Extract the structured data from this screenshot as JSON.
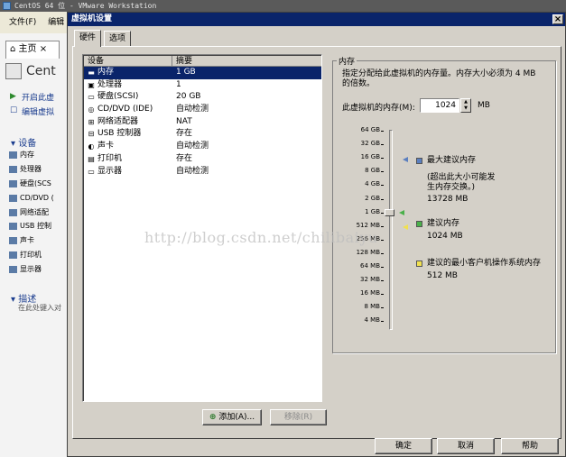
{
  "background": {
    "title": "CentOS 64 位 - VMware Workstation",
    "menu": [
      "文件(F)",
      "编辑"
    ],
    "home_tab": "主页",
    "vm_title": "Cent",
    "actions": [
      "开启此虚",
      "编辑虚拟"
    ],
    "devices_heading": "设备",
    "devices": [
      "内存",
      "处理器",
      "硬盘(SCS",
      "CD/DVD (",
      "网络适配",
      "USB 控制",
      "声卡",
      "打印机",
      "显示器"
    ],
    "description_heading": "描述",
    "description_placeholder": "在此处键入对"
  },
  "dialog": {
    "title": "虚拟机设置",
    "tabs": [
      "硬件",
      "选项"
    ],
    "device_table": {
      "headers": [
        "设备",
        "摘要"
      ],
      "rows": [
        {
          "icon": "memory-icon",
          "device": "内存",
          "summary": "1 GB",
          "selected": true
        },
        {
          "icon": "cpu-icon",
          "device": "处理器",
          "summary": "1"
        },
        {
          "icon": "hard-disk-icon",
          "device": "硬盘(SCSI)",
          "summary": "20 GB"
        },
        {
          "icon": "cd-dvd-icon",
          "device": "CD/DVD (IDE)",
          "summary": "自动检测"
        },
        {
          "icon": "network-adapter-icon",
          "device": "网络适配器",
          "summary": "NAT"
        },
        {
          "icon": "usb-controller-icon",
          "device": "USB 控制器",
          "summary": "存在"
        },
        {
          "icon": "sound-card-icon",
          "device": "声卡",
          "summary": "自动检测"
        },
        {
          "icon": "printer-icon",
          "device": "打印机",
          "summary": "存在"
        },
        {
          "icon": "display-icon",
          "device": "显示器",
          "summary": "自动检测"
        }
      ]
    },
    "add_label": "添加(A)...",
    "remove_label": "移除(R)",
    "memory": {
      "group_title": "内存",
      "description": "指定分配给此虚拟机的内存量。内存大小必须为 4 MB 的倍数。",
      "field_label": "此虚拟机的内存(M):",
      "value": "1024",
      "unit": "MB",
      "scale": [
        "64 GB",
        "32 GB",
        "16 GB",
        "8 GB",
        "4 GB",
        "2 GB",
        "1 GB",
        "512 MB",
        "256 MB",
        "128 MB",
        "64 MB",
        "32 MB",
        "16 MB",
        "8 MB",
        "4 MB"
      ],
      "current_level": "1 GB",
      "legend": {
        "max_label": "最大建议内存",
        "max_note": "(超出此大小可能发生内存交换。)",
        "max_value": "13728 MB",
        "rec_label": "建议内存",
        "rec_value": "1024 MB",
        "min_label": "建议的最小客户机操作系统内存",
        "min_value": "512 MB"
      },
      "colors": {
        "max": "#5b7fbf",
        "recommended": "#4ab04a",
        "minimum": "#f0e050"
      }
    },
    "buttons": {
      "ok": "确定",
      "cancel": "取消",
      "help": "帮助"
    }
  },
  "watermark": "http://blog.csdn.net/chilibaiyu"
}
